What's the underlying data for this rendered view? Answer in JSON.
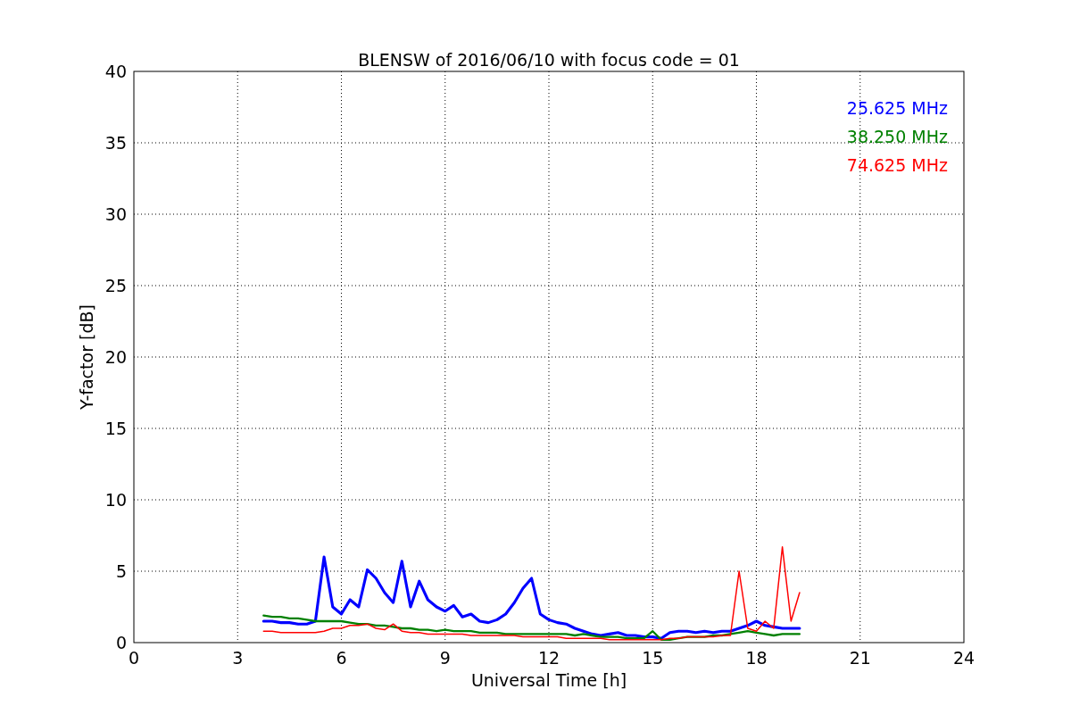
{
  "chart_data": {
    "type": "line",
    "title": "BLENSW of 2016/06/10 with focus code = 01",
    "xlabel": "Universal Time [h]",
    "ylabel": "Y-factor [dB]",
    "x": [
      3.75,
      4,
      4.25,
      4.5,
      4.75,
      5,
      5.25,
      5.5,
      5.75,
      6,
      6.25,
      6.5,
      6.75,
      7,
      7.25,
      7.5,
      7.75,
      8,
      8.25,
      8.5,
      8.75,
      9,
      9.25,
      9.5,
      9.75,
      10,
      10.25,
      10.5,
      10.75,
      11,
      11.25,
      11.5,
      11.75,
      12,
      12.25,
      12.5,
      12.75,
      13,
      13.25,
      13.5,
      13.75,
      14,
      14.25,
      14.5,
      14.75,
      15,
      15.25,
      15.5,
      15.75,
      16,
      16.25,
      16.5,
      16.75,
      17,
      17.25,
      17.5,
      17.75,
      18,
      18.25,
      18.5,
      18.75,
      19,
      19.25
    ],
    "series": [
      {
        "name": "25.625 MHz",
        "color": "#0000ff",
        "values": [
          1.5,
          1.5,
          1.4,
          1.4,
          1.3,
          1.3,
          1.5,
          6.0,
          2.5,
          2.0,
          3.0,
          2.5,
          5.1,
          4.5,
          3.5,
          2.8,
          5.7,
          2.5,
          4.3,
          3.0,
          2.5,
          2.2,
          2.6,
          1.8,
          2.0,
          1.5,
          1.4,
          1.6,
          2.0,
          2.8,
          3.8,
          4.5,
          2.0,
          1.6,
          1.4,
          1.3,
          1.0,
          0.8,
          0.6,
          0.5,
          0.6,
          0.7,
          0.5,
          0.5,
          0.4,
          0.4,
          0.3,
          0.7,
          0.8,
          0.8,
          0.7,
          0.8,
          0.7,
          0.8,
          0.8,
          1.0,
          1.2,
          1.5,
          1.2,
          1.1,
          1.0,
          1.0,
          1.0
        ]
      },
      {
        "name": "38.250 MHz",
        "color": "#008000",
        "values": [
          1.9,
          1.8,
          1.8,
          1.7,
          1.7,
          1.6,
          1.5,
          1.5,
          1.5,
          1.5,
          1.4,
          1.3,
          1.3,
          1.2,
          1.2,
          1.1,
          1.0,
          1.0,
          0.9,
          0.9,
          0.8,
          0.9,
          0.8,
          0.8,
          0.8,
          0.7,
          0.7,
          0.7,
          0.6,
          0.6,
          0.6,
          0.6,
          0.6,
          0.6,
          0.6,
          0.6,
          0.5,
          0.6,
          0.5,
          0.4,
          0.4,
          0.4,
          0.3,
          0.3,
          0.3,
          0.8,
          0.2,
          0.2,
          0.3,
          0.4,
          0.4,
          0.4,
          0.5,
          0.5,
          0.6,
          0.7,
          0.8,
          0.7,
          0.6,
          0.5,
          0.6,
          0.6,
          0.6
        ]
      },
      {
        "name": "74.625 MHz",
        "color": "#ff0000",
        "values": [
          0.8,
          0.8,
          0.7,
          0.7,
          0.7,
          0.7,
          0.7,
          0.8,
          1.0,
          1.0,
          1.2,
          1.2,
          1.3,
          1.0,
          0.9,
          1.3,
          0.8,
          0.7,
          0.7,
          0.6,
          0.6,
          0.6,
          0.6,
          0.6,
          0.5,
          0.5,
          0.5,
          0.5,
          0.5,
          0.5,
          0.4,
          0.4,
          0.4,
          0.4,
          0.4,
          0.3,
          0.3,
          0.3,
          0.3,
          0.3,
          0.2,
          0.2,
          0.2,
          0.2,
          0.2,
          0.2,
          0.2,
          0.3,
          0.3,
          0.4,
          0.4,
          0.4,
          0.4,
          0.5,
          0.5,
          5.0,
          1.0,
          0.8,
          1.5,
          1.0,
          6.7,
          1.5,
          3.5
        ]
      }
    ],
    "xlim": [
      0,
      24
    ],
    "ylim": [
      0,
      40
    ],
    "xticks": [
      0,
      3,
      6,
      9,
      12,
      15,
      18,
      21,
      24
    ],
    "yticks": [
      0,
      5,
      10,
      15,
      20,
      25,
      30,
      35,
      40
    ],
    "grid": true
  }
}
